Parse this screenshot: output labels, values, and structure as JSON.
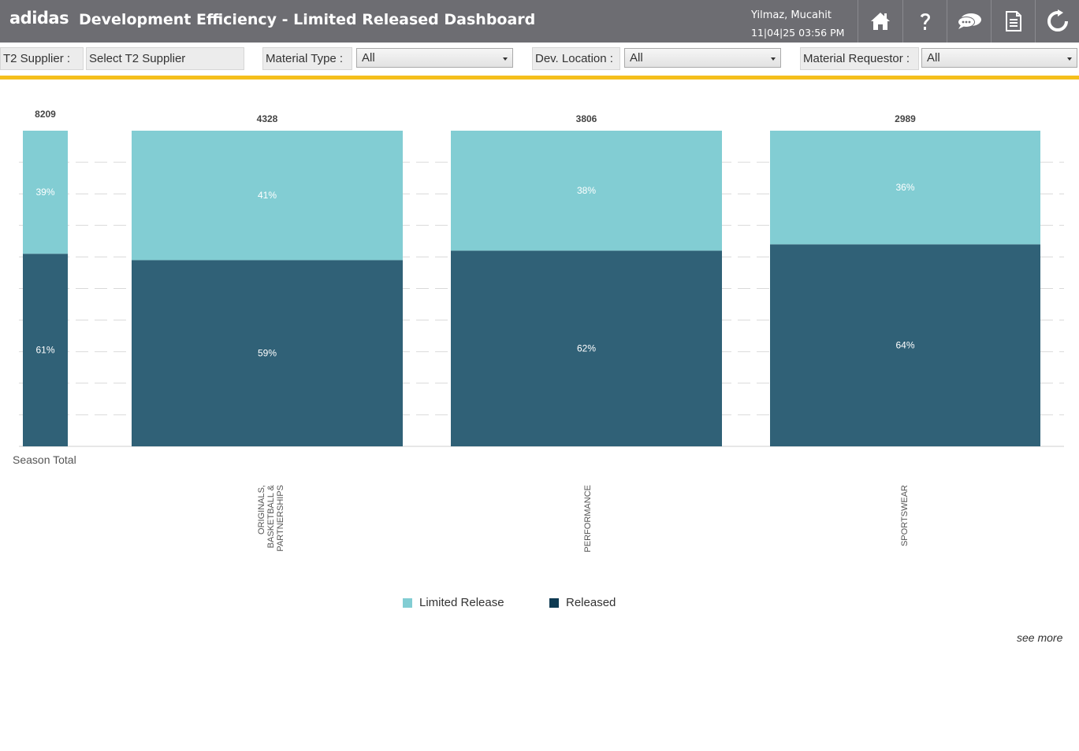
{
  "header": {
    "logo": "adidas",
    "title": "Development Efficiency - Limited Released Dashboard",
    "user_name": "Yilmaz, Mucahit",
    "datetime": "11|04|25 03:56 PM",
    "buttons": [
      {
        "icon": "home-icon"
      },
      {
        "icon": "help-icon"
      },
      {
        "icon": "chat-icon"
      },
      {
        "icon": "document-icon"
      },
      {
        "icon": "refresh-icon"
      }
    ]
  },
  "filters": {
    "t2_supplier_label": "T2 Supplier :",
    "t2_supplier_placeholder": "Select T2 Supplier",
    "material_type_label": "Material Type :",
    "material_type_value": "All",
    "dev_location_label": "Dev. Location :",
    "dev_location_value": "All",
    "material_requestor_label": "Material Requestor :",
    "material_requestor_value": "All"
  },
  "colors": {
    "header_bg": "#6d6d72",
    "accent": "#f5bf1b",
    "limited_release": "#82cdd3",
    "released": "#306177",
    "legend_released": "#0e3a52"
  },
  "chart_data": {
    "type": "bar",
    "stacked": true,
    "normalized": true,
    "categories": [
      "Season Total",
      "ORIGINALS, BASKETBALL & PARTNERSHIPS",
      "PERFORMANCE",
      "SPORTSWEAR"
    ],
    "totals": [
      8209,
      4328,
      3806,
      2989
    ],
    "series": [
      {
        "name": "Limited Release",
        "values": [
          39,
          41,
          38,
          36
        ],
        "labels": [
          "39%",
          "41%",
          "38%",
          "36%"
        ]
      },
      {
        "name": "Released",
        "values": [
          61,
          59,
          62,
          64
        ],
        "labels": [
          "61%",
          "59%",
          "62%",
          "64%"
        ]
      }
    ],
    "ylim": [
      0,
      100
    ],
    "grid": true,
    "legend": "bottom-center"
  },
  "see_more": "see more"
}
